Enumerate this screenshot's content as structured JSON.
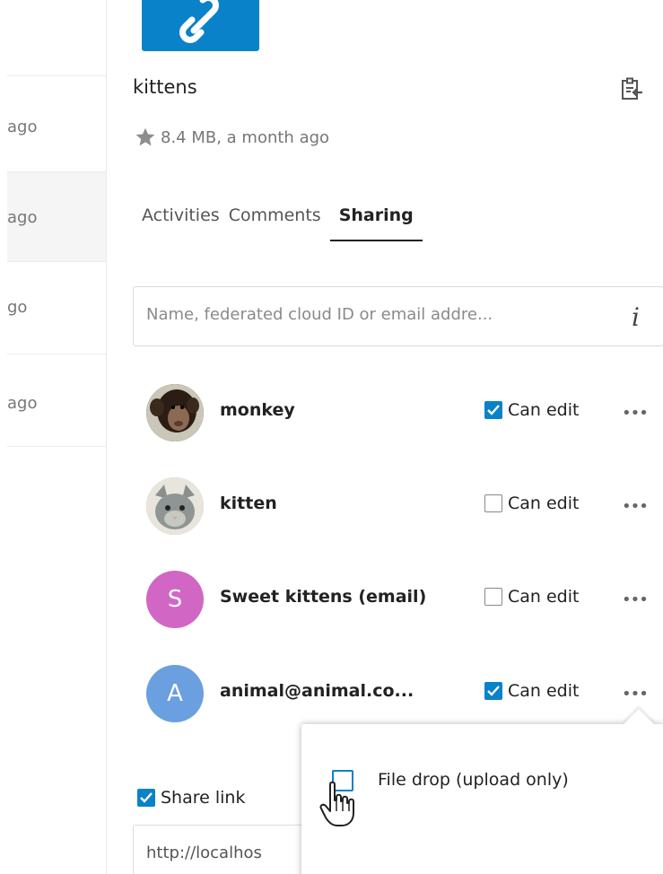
{
  "file_list": {
    "rows": [
      {
        "text": "ago"
      },
      {
        "text": "ago"
      },
      {
        "text": "go"
      },
      {
        "text": "ago"
      }
    ]
  },
  "file": {
    "name": "kittens",
    "size_time": "8.4 MB, a month ago"
  },
  "tabs": [
    {
      "label": "Activities"
    },
    {
      "label": "Comments"
    },
    {
      "label": "Sharing"
    }
  ],
  "search": {
    "placeholder": "Name, federated cloud ID or email addre..."
  },
  "shares": [
    {
      "name": "monkey",
      "permission_label": "Can edit",
      "can_edit": true,
      "avatar_letter": ""
    },
    {
      "name": "kitten",
      "permission_label": "Can edit",
      "can_edit": false,
      "avatar_letter": ""
    },
    {
      "name": "Sweet kittens (email)",
      "permission_label": "Can edit",
      "can_edit": false,
      "avatar_letter": "S",
      "avatar_color": "#d166c4"
    },
    {
      "name": "animal@animal.co...",
      "permission_label": "Can edit",
      "can_edit": true,
      "avatar_letter": "A",
      "avatar_color": "#6a9fe0"
    }
  ],
  "share_link": {
    "label": "Share link",
    "checked": true,
    "url": "http://localhos"
  },
  "popover": {
    "item_label": "File drop (upload only)"
  },
  "colors": {
    "accent": "#0a82c9"
  }
}
